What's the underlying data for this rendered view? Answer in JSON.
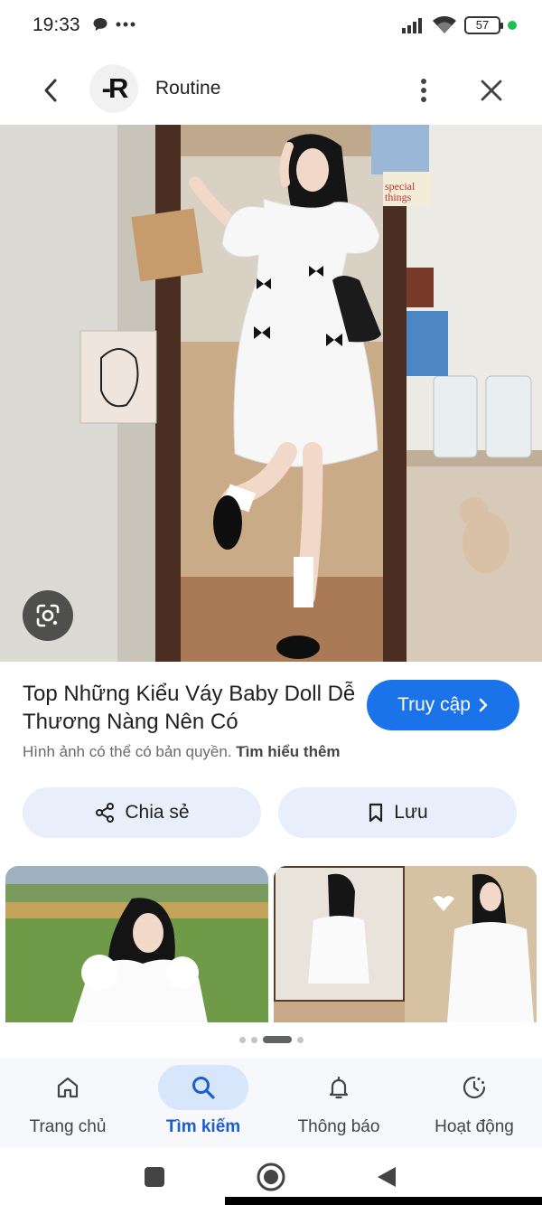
{
  "status_bar": {
    "time": "19:33",
    "battery": "57",
    "icons": [
      "chat-bubble-icon",
      "more-dots-icon",
      "signal-icon",
      "wifi-icon",
      "battery-icon"
    ]
  },
  "app_bar": {
    "logo_text": "-R",
    "title": "Routine"
  },
  "main_image": {
    "sticker_text": "special things"
  },
  "result": {
    "title": "Top Những Kiểu Váy Baby Doll Dễ Thương Nàng Nên Có",
    "visit_label": "Truy cập",
    "copyright_text": "Hình ảnh có thể có bản quyền.",
    "learn_more": "Tìm hiểu thêm"
  },
  "actions": {
    "share_label": "Chia sẻ",
    "save_label": "Lưu"
  },
  "pager": {
    "count": 4,
    "active": 2
  },
  "bottom_nav": {
    "items": [
      {
        "label": "Trang chủ",
        "icon": "home-icon",
        "active": false
      },
      {
        "label": "Tìm kiếm",
        "icon": "search-icon",
        "active": true
      },
      {
        "label": "Thông báo",
        "icon": "bell-icon",
        "active": false
      },
      {
        "label": "Hoạt động",
        "icon": "activity-icon",
        "active": false
      }
    ]
  },
  "colors": {
    "accent": "#1a73e8",
    "pill_bg": "#e8effa",
    "nav_active_bg": "#d8e6fb",
    "nav_active_text": "#1a5fcf"
  }
}
